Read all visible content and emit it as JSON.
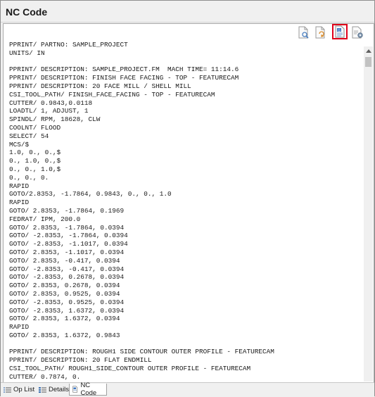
{
  "window": {
    "title": "NC Code"
  },
  "toolbar": {
    "buttons": [
      {
        "icon": "find-in-document-icon"
      },
      {
        "icon": "refresh-document-icon"
      },
      {
        "icon": "save-nc-code-icon",
        "highlight_color": "#e0001b"
      },
      {
        "icon": "nc-settings-icon"
      }
    ]
  },
  "code": {
    "lines": [
      "PPRINT/ PARTNO: SAMPLE_PROJECT",
      "UNITS/ IN",
      "",
      "PPRINT/ DESCRIPTION: SAMPLE_PROJECT.FM  MACH TIME= 11:14.6",
      "PPRINT/ DESCRIPTION: FINISH FACE FACING - TOP - FEATURECAM",
      "PPRINT/ DESCRIPTION: 20 FACE MILL / SHELL MILL",
      "CSI_TOOL_PATH/ FINISH_FACE_FACING - TOP - FEATURECAM",
      "CUTTER/ 0.9843,0.0118",
      "LOADTL/ 1, ADJUST, 1",
      "SPINDL/ RPM, 18628, CLW",
      "COOLNT/ FLOOD",
      "SELECT/ 54",
      "MCS/$",
      "1.0, 0., 0.,$",
      "0., 1.0, 0.,$",
      "0., 0., 1.0,$",
      "0., 0., 0.",
      "RAPID",
      "GOTO/2.8353, -1.7864, 0.9843, 0., 0., 1.0",
      "RAPID",
      "GOTO/ 2.8353, -1.7864, 0.1969",
      "FEDRAT/ IPM, 200.0",
      "GOTO/ 2.8353, -1.7864, 0.0394",
      "GOTO/ -2.8353, -1.7864, 0.0394",
      "GOTO/ -2.8353, -1.1017, 0.0394",
      "GOTO/ 2.8353, -1.1017, 0.0394",
      "GOTO/ 2.8353, -0.417, 0.0394",
      "GOTO/ -2.8353, -0.417, 0.0394",
      "GOTO/ -2.8353, 0.2678, 0.0394",
      "GOTO/ 2.8353, 0.2678, 0.0394",
      "GOTO/ 2.8353, 0.9525, 0.0394",
      "GOTO/ -2.8353, 0.9525, 0.0394",
      "GOTO/ -2.8353, 1.6372, 0.0394",
      "GOTO/ 2.8353, 1.6372, 0.0394",
      "RAPID",
      "GOTO/ 2.8353, 1.6372, 0.9843",
      "",
      "PPRINT/ DESCRIPTION: ROUGH1 SIDE CONTOUR OUTER PROFILE - FEATURECAM",
      "PPRINT/ DESCRIPTION: 20 FLAT ENDMILL",
      "CSI_TOOL_PATH/ ROUGH1_SIDE_CONTOUR OUTER PROFILE - FEATURECAM",
      "CUTTER/ 0.7874, 0."
    ]
  },
  "tabs": [
    {
      "label": "Op List",
      "icon": "list-icon"
    },
    {
      "label": "Details",
      "icon": "details-icon"
    },
    {
      "label": "NC Code",
      "icon": "nc-code-icon",
      "active": true
    }
  ]
}
